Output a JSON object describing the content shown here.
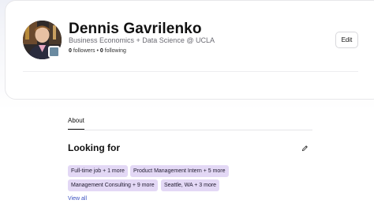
{
  "profile": {
    "name": "Dennis Gavrilenko",
    "headline": "Business Economics + Data Science @ UCLA",
    "followers_count": "0",
    "followers_label": "followers",
    "separator": "•",
    "following_count": "0",
    "following_label": "following",
    "edit_label": "Edit"
  },
  "tabs": [
    {
      "label": "About",
      "active": true
    }
  ],
  "looking_for": {
    "title": "Looking for",
    "chips": [
      "Full-time job + 1 more",
      "Product Management Intern + 5 more",
      "Management Consulting + 9 more",
      "Seattle, WA + 3 more"
    ],
    "view_all_label": "View all"
  },
  "colors": {
    "chip_bg": "#e3d8f5",
    "link": "#3a4fbf"
  },
  "icons": {
    "edit": "pencil-icon"
  }
}
